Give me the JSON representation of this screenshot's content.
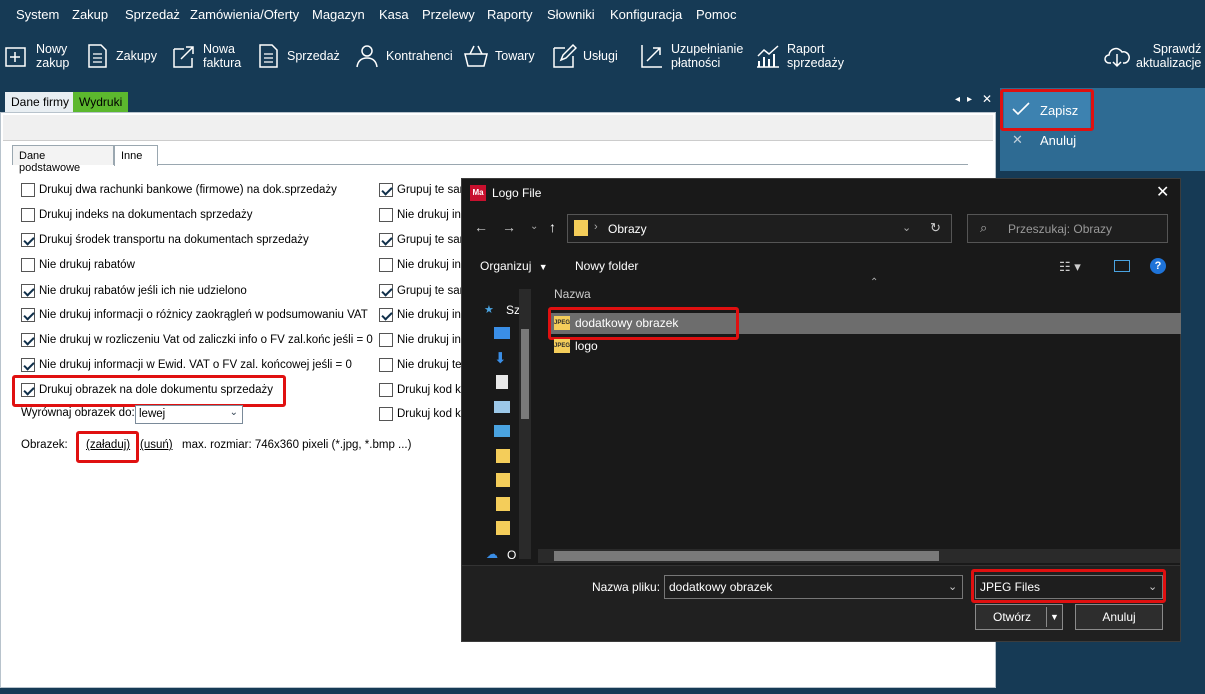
{
  "menu": [
    "System",
    "Zakup",
    "Sprzedaż",
    "Zamówienia/Oferty",
    "Magazyn",
    "Kasa",
    "Przelewy",
    "Raporty",
    "Słowniki",
    "Konfiguracja",
    "Pomoc"
  ],
  "toolbar": [
    {
      "line1": "Nowy",
      "line2": "zakup",
      "icon": "new-purchase-icon"
    },
    {
      "line1": "Zakupy",
      "line2": "",
      "icon": "purchases-document-icon"
    },
    {
      "line1": "Nowa",
      "line2": "faktura",
      "icon": "new-invoice-icon"
    },
    {
      "line1": "Sprzedaż",
      "line2": "",
      "icon": "sales-document-icon"
    },
    {
      "line1": "Kontrahenci",
      "line2": "",
      "icon": "person-icon"
    },
    {
      "line1": "Towary",
      "line2": "",
      "icon": "basket-icon"
    },
    {
      "line1": "Usługi",
      "line2": "",
      "icon": "pen-document-icon"
    },
    {
      "line1": "Uzupełnianie",
      "line2": "płatności",
      "icon": "payment-arrow-icon"
    },
    {
      "line1": "Raport",
      "line2": "sprzedaży",
      "icon": "chart-icon"
    },
    {
      "line1": "Sprawdź",
      "line2": "aktualizacje",
      "icon": "cloud-download-icon"
    }
  ],
  "tabs": {
    "dane_firmy": "Dane firmy",
    "wydruki": "Wydruki"
  },
  "inner_tabs": {
    "dane_podstawowe": "Dane podstawowe",
    "inne": "Inne"
  },
  "left_options": [
    {
      "label": "Drukuj dwa rachunki bankowe (firmowe) na dok.sprzedaży",
      "checked": false
    },
    {
      "label": "Drukuj indeks na dokumentach sprzedaży",
      "checked": false
    },
    {
      "label": "Drukuj środek transportu na dokumentach sprzedaży",
      "checked": true
    },
    {
      "label": "Nie drukuj rabatów",
      "checked": false
    },
    {
      "label": "Nie drukuj rabatów jeśli ich nie udzielono",
      "checked": true
    },
    {
      "label": "Nie drukuj informacji o różnicy zaokrągleń w podsumowaniu VAT",
      "checked": true
    },
    {
      "label": "Nie drukuj w rozliczeniu Vat od zaliczki info o FV zal.końc jeśli = 0",
      "checked": true
    },
    {
      "label": "Nie drukuj informacji w Ewid. VAT o FV zal. końcowej jeśli = 0",
      "checked": true
    },
    {
      "label": "Drukuj obrazek na dole dokumentu sprzedaży",
      "checked": true
    }
  ],
  "right_options": [
    {
      "label": "Grupuj te sar",
      "checked": true
    },
    {
      "label": "Nie drukuj inf",
      "checked": false
    },
    {
      "label": "Grupuj te sar",
      "checked": true
    },
    {
      "label": "Nie drukuj inf",
      "checked": false
    },
    {
      "label": "Grupuj te sar",
      "checked": true
    },
    {
      "label": "Nie drukuj inform",
      "checked": true
    },
    {
      "label": "Nie drukuj inf",
      "checked": false
    },
    {
      "label": "Nie drukuj ter",
      "checked": false
    },
    {
      "label": "Drukuj kod kr",
      "checked": false
    },
    {
      "label": "Drukuj kod kr",
      "checked": false
    }
  ],
  "align": {
    "label": "Wyrównaj obrazek do:",
    "value": "lewej"
  },
  "image_row": {
    "label": "Obrazek:",
    "load": "(załaduj)",
    "remove": "(usuń)",
    "hint": "max. rozmiar: 746x360 pixeli (*.jpg, *.bmp ...)"
  },
  "actions": {
    "save": "Zapisz",
    "cancel": "Anuluj"
  },
  "dialog": {
    "title": "Logo File",
    "app_icon_text": "Ma",
    "breadcrumb": "Obrazy",
    "search_placeholder": "Przeszukaj: Obrazy",
    "organize": "Organizuj",
    "new_folder": "Nowy folder",
    "column_name": "Nazwa",
    "nav_first": "Sz",
    "nav_last": "O",
    "files": [
      {
        "name": "dodatkowy obrazek",
        "badge": "JPEG",
        "selected": true
      },
      {
        "name": "logo",
        "badge": "JPEG",
        "selected": false
      }
    ],
    "filename_label": "Nazwa pliku:",
    "filename_value": "dodatkowy obrazek",
    "filter": "JPEG Files",
    "open": "Otwórz",
    "cancel": "Anuluj"
  },
  "colors": {
    "background": "#163a55",
    "accent_tab": "#5cb82e",
    "highlight": "#e01010",
    "dialog_bg": "#191919"
  }
}
